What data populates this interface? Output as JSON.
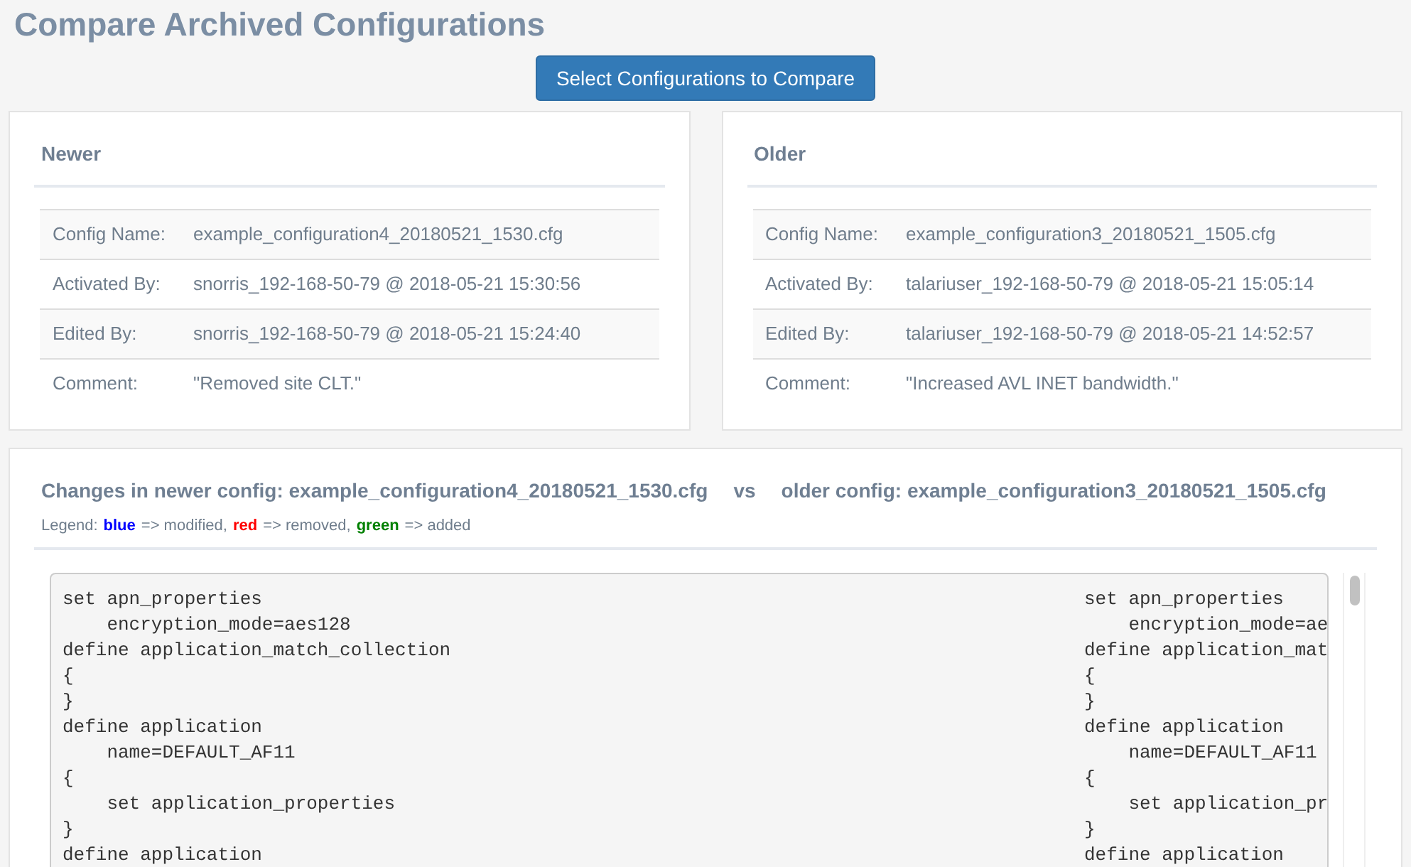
{
  "title": "Compare Archived Configurations",
  "select_button": "Select Configurations to Compare",
  "panels": [
    {
      "heading": "Newer",
      "rows": [
        {
          "label": "Config Name:",
          "value": "example_configuration4_20180521_1530.cfg"
        },
        {
          "label": "Activated By:",
          "value": "snorris_192-168-50-79 @ 2018-05-21 15:30:56"
        },
        {
          "label": "Edited By:",
          "value": "snorris_192-168-50-79 @ 2018-05-21 15:24:40"
        },
        {
          "label": "Comment:",
          "value": "\"Removed site CLT.\""
        }
      ]
    },
    {
      "heading": "Older",
      "rows": [
        {
          "label": "Config Name:",
          "value": "example_configuration3_20180521_1505.cfg"
        },
        {
          "label": "Activated By:",
          "value": "talariuser_192-168-50-79 @ 2018-05-21 15:05:14"
        },
        {
          "label": "Edited By:",
          "value": "talariuser_192-168-50-79 @ 2018-05-21 14:52:57"
        },
        {
          "label": "Comment:",
          "value": "\"Increased AVL INET bandwidth.\""
        }
      ]
    }
  ],
  "changes": {
    "newer_heading": "Changes in newer config: **example_configuration4_20180521_1530.cfg**",
    "separator": "vs",
    "older_heading": "older config: **example_configuration3_20180521_1505.cfg**",
    "legend": {
      "label": "Legend:",
      "items": [
        {
          "word": "blue",
          "color": "#0000ff",
          "meaning": "=> modified,"
        },
        {
          "word": "red",
          "color": "#ff0000",
          "meaning": "=> removed,"
        },
        {
          "word": "green",
          "color": "#008000",
          "meaning": "=> added"
        }
      ]
    },
    "newer_lines": [
      "set apn_properties",
      "    encryption_mode=aes128",
      "define application_match_collection",
      "{",
      "}",
      "define application",
      "    name=DEFAULT_AF11",
      "{",
      "    set application_properties",
      "}",
      "define application"
    ],
    "older_lines": [
      "set apn_properties",
      "    encryption_mode=ae",
      "define application_mat",
      "{",
      "}",
      "define application",
      "    name=DEFAULT_AF11",
      "{",
      "    set application_pr",
      "}",
      "define application"
    ]
  }
}
